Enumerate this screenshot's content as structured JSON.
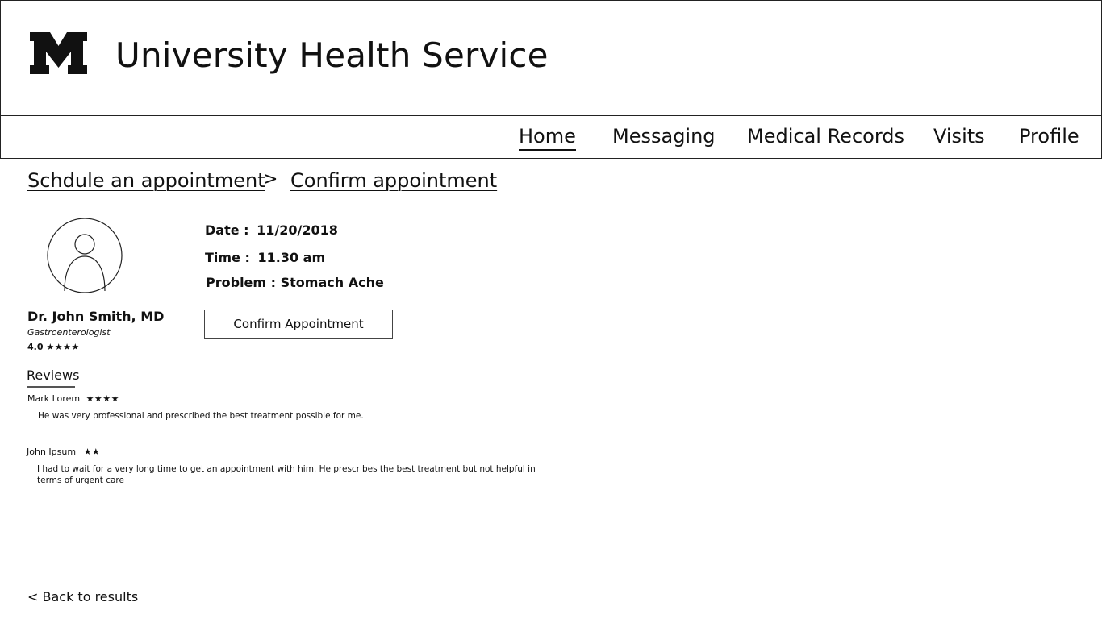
{
  "header": {
    "logo_text": "M",
    "title": "University Health Service"
  },
  "nav": {
    "items": [
      {
        "label": "Home",
        "active": true
      },
      {
        "label": "Messaging",
        "active": false
      },
      {
        "label": "Medical Records",
        "active": false
      },
      {
        "label": "Visits",
        "active": false
      },
      {
        "label": "Profile",
        "active": false
      }
    ]
  },
  "breadcrumb": {
    "step1": "Schdule an appointment",
    "separator": ">",
    "step2": "Confirm appointment"
  },
  "doctor": {
    "name": "Dr. John Smith, MD",
    "specialty": "Gastroenterologist",
    "rating": "4.0",
    "rating_stars": "★★★★"
  },
  "appointment": {
    "date_label": "Date :",
    "date_value": "11/20/2018",
    "time_label": "Time :",
    "time_value": "11.30 am",
    "problem_label": "Problem :",
    "problem_value": "Stomach Ache",
    "confirm_label": "Confirm Appointment"
  },
  "reviews": {
    "title": "Reviews",
    "items": [
      {
        "author": "Mark Lorem",
        "stars": "★★★★",
        "text": "He was very professional and prescribed the best treatment possible for me."
      },
      {
        "author": "John Ipsum",
        "stars": "★★",
        "text": "I had to wait for a very long time to get an appointment with him. He prescribes the best treatment but not helpful in terms of urgent care"
      }
    ]
  },
  "back_link": "< Back to results"
}
